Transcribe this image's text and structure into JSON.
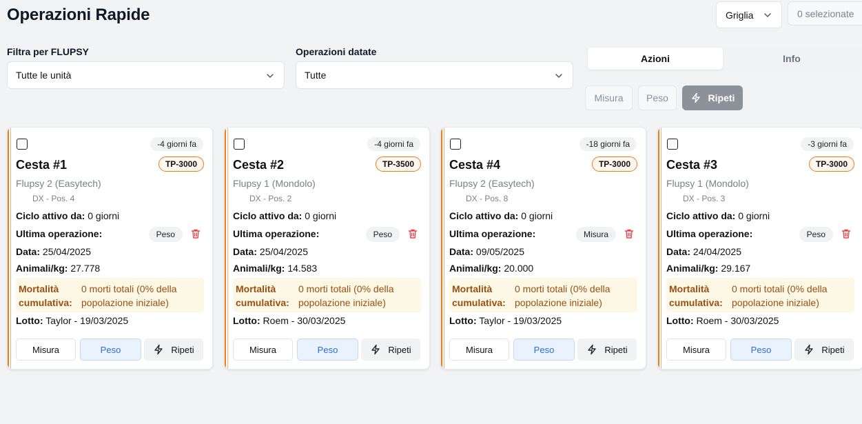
{
  "header": {
    "title": "Operazioni Rapide",
    "view_mode": "Griglia",
    "selected_count": "0 selezionate"
  },
  "filters": {
    "flupsy": {
      "label": "Filtra per FLUPSY",
      "value": "Tutte le unità"
    },
    "dated": {
      "label": "Operazioni datate",
      "value": "Tutte"
    }
  },
  "tabs": [
    {
      "label": "Azioni",
      "active": true
    },
    {
      "label": "Info",
      "active": false
    }
  ],
  "bulk_actions": {
    "misura": "Misura",
    "peso": "Peso",
    "ripeti": "Ripeti"
  },
  "labels": {
    "ciclo": "Ciclo attivo da:",
    "ultima": "Ultima operazione:",
    "data": "Data:",
    "animali": "Animali/kg:",
    "mortalita": "Mortalità cumulativa:",
    "lotto": "Lotto:",
    "btn_misura": "Misura",
    "btn_peso": "Peso",
    "btn_ripeti": "Ripeti"
  },
  "colors": {
    "accent": "#ea7c1d",
    "peso_blue": "#2d6dd1",
    "delete_red": "#e5484d",
    "mortality_bg": "#fdf8e5"
  },
  "cards": [
    {
      "ago": "-4 giorni fa",
      "name": "Cesta #1",
      "type": "TP-3000",
      "flupsy": "Flupsy 2 (Easytech)",
      "position": "DX - Pos. 4",
      "cycle": "0 giorni",
      "last_op": "Peso",
      "date": "25/04/2025",
      "animals_kg": "27.778",
      "mortality": "0 morti totali (0% della popolazione iniziale)",
      "lot": "Taylor - 19/03/2025"
    },
    {
      "ago": "-4 giorni fa",
      "name": "Cesta #2",
      "type": "TP-3500",
      "flupsy": "Flupsy 1 (Mondolo)",
      "position": "DX - Pos. 2",
      "cycle": "0 giorni",
      "last_op": "Peso",
      "date": "25/04/2025",
      "animals_kg": "14.583",
      "mortality": "0 morti totali (0% della popolazione iniziale)",
      "lot": "Roem - 30/03/2025"
    },
    {
      "ago": "-18 giorni fa",
      "name": "Cesta #4",
      "type": "TP-3000",
      "flupsy": "Flupsy 2 (Easytech)",
      "position": "DX - Pos. 8",
      "cycle": "0 giorni",
      "last_op": "Misura",
      "date": "09/05/2025",
      "animals_kg": "20.000",
      "mortality": "0 morti totali (0% della popolazione iniziale)",
      "lot": "Taylor - 19/03/2025"
    },
    {
      "ago": "-3 giorni fa",
      "name": "Cesta #3",
      "type": "TP-3000",
      "flupsy": "Flupsy 1 (Mondolo)",
      "position": "DX - Pos. 3",
      "cycle": "0 giorni",
      "last_op": "Peso",
      "date": "24/04/2025",
      "animals_kg": "29.167",
      "mortality": "0 morti totali (0% della popolazione iniziale)",
      "lot": "Roem - 30/03/2025"
    }
  ]
}
